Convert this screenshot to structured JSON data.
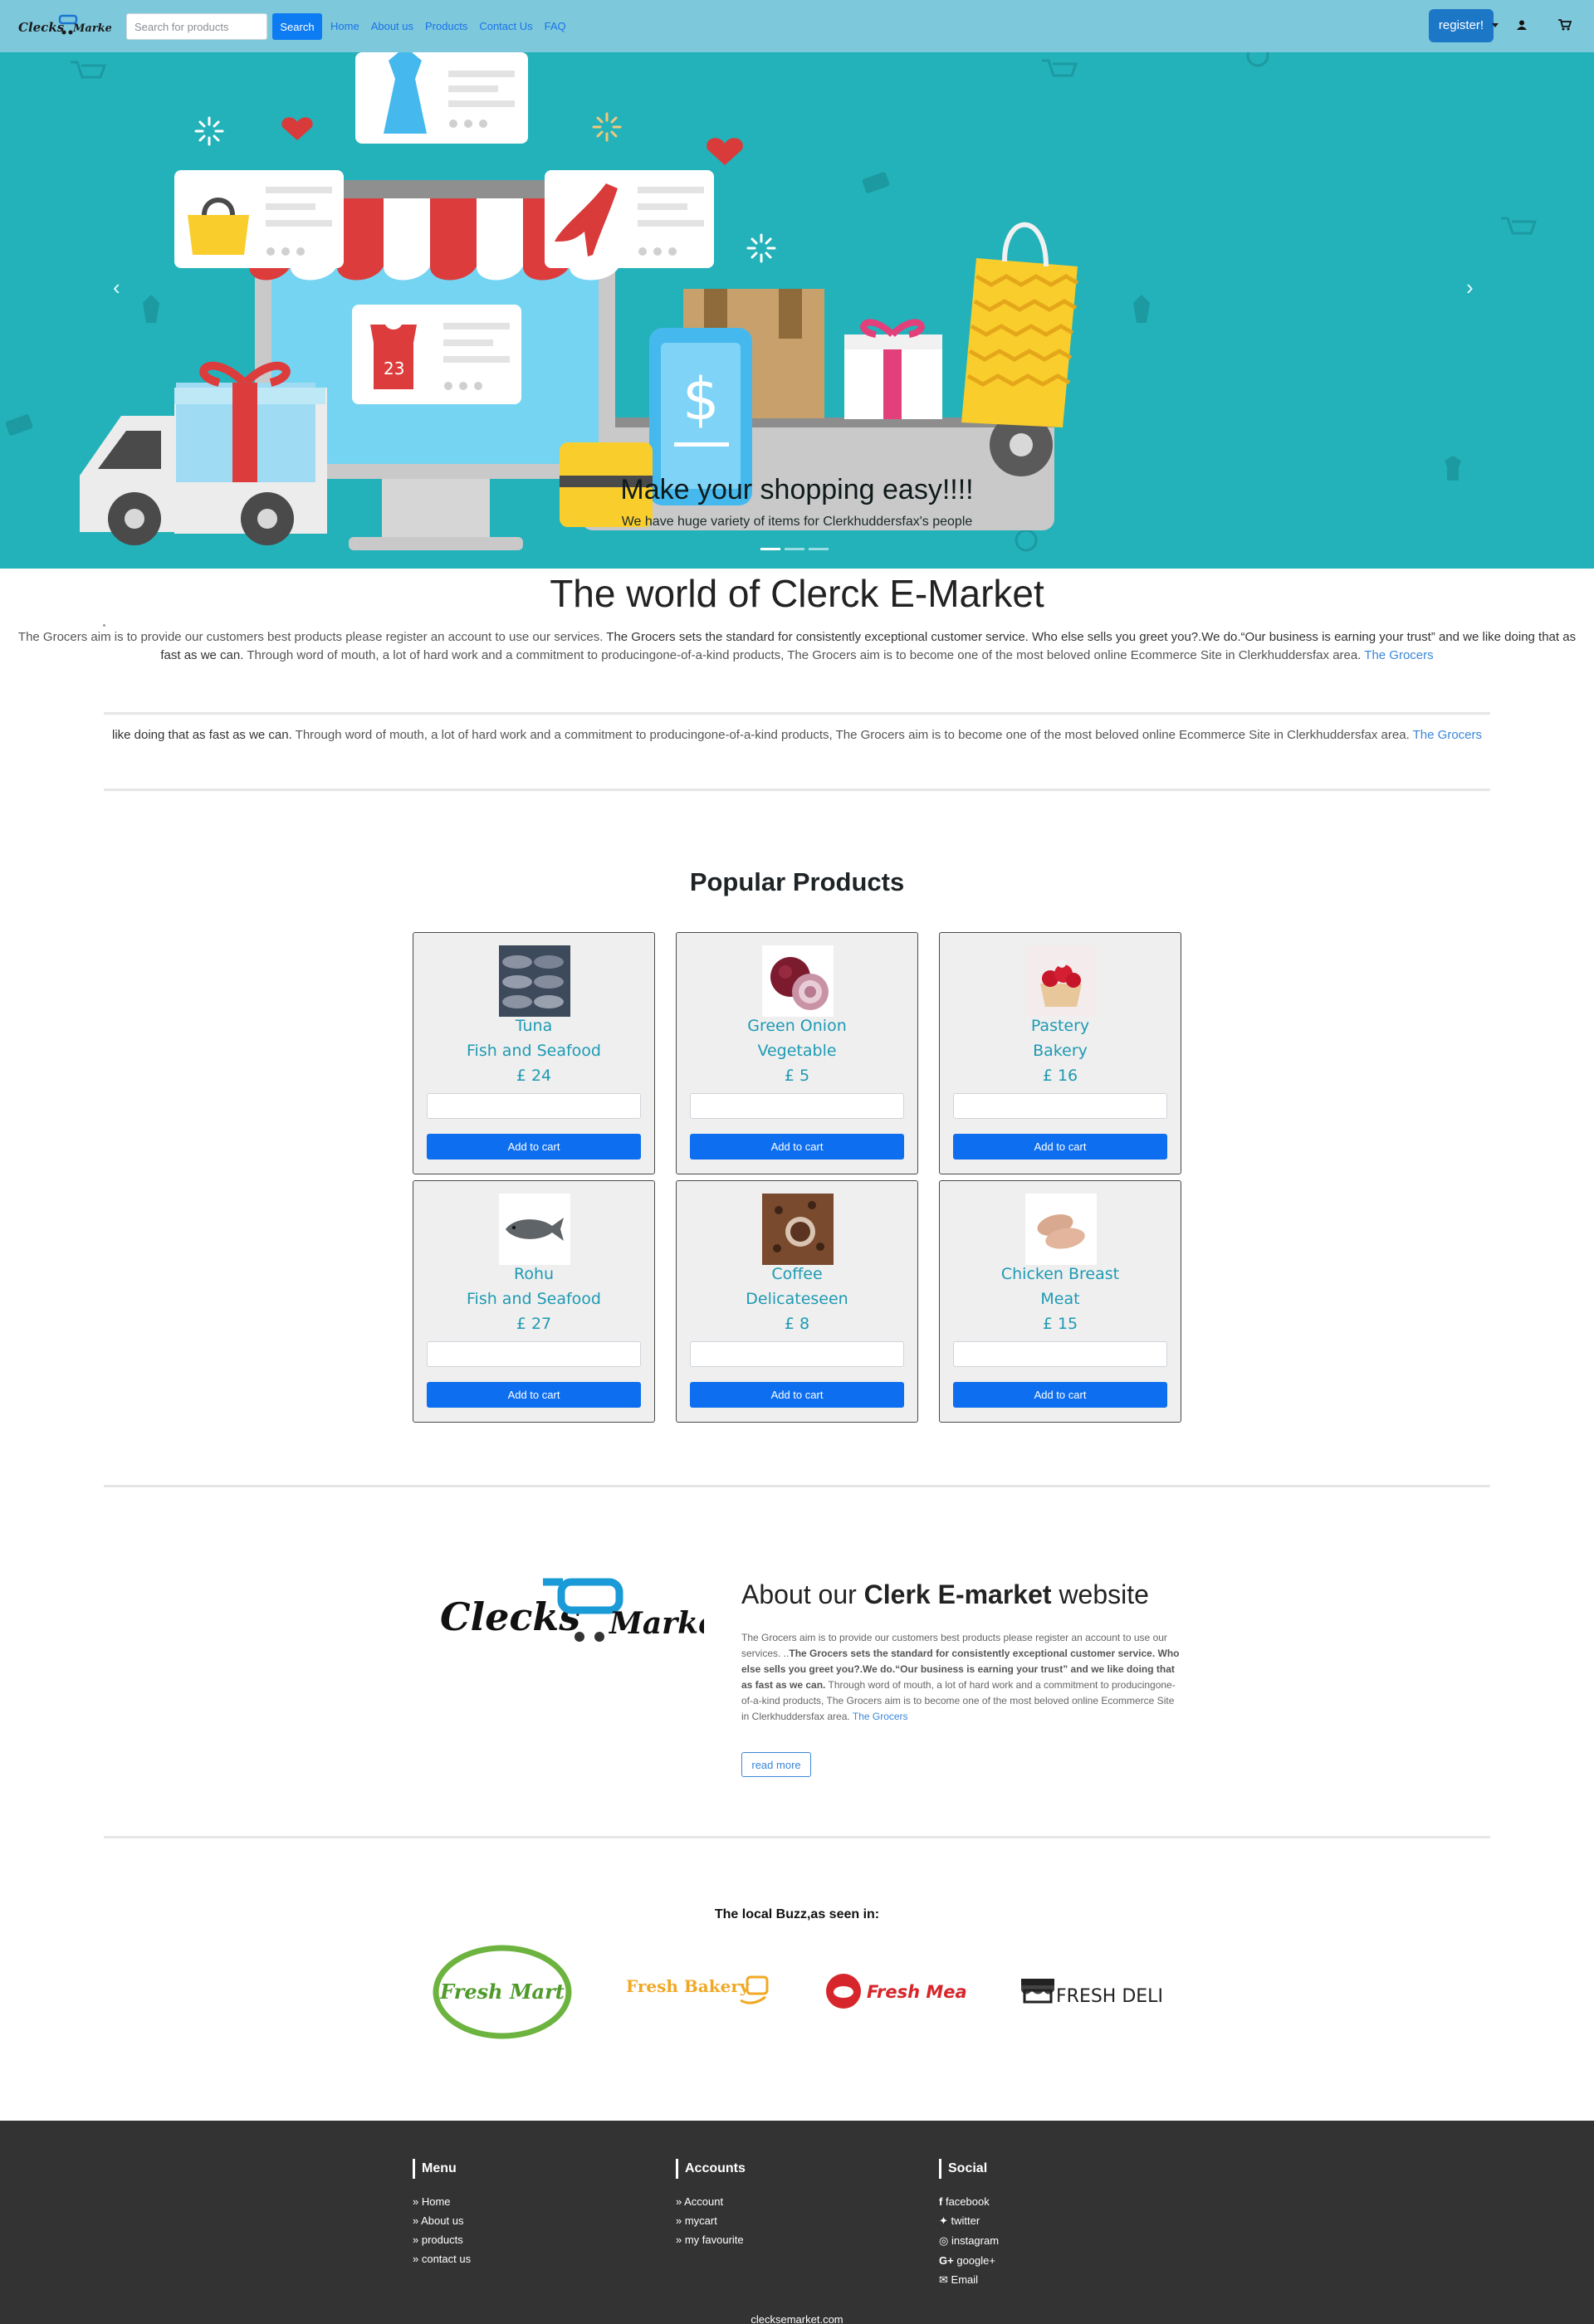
{
  "navbar": {
    "logo_text": "Clecks Market",
    "search_placeholder": "Search for products",
    "search_button": "Search",
    "links": [
      "Home",
      "About us",
      "Products",
      "Contact Us",
      "FAQ"
    ],
    "register_label": "register!"
  },
  "hero": {
    "title": "Make your shopping easy!!!!",
    "subtitle": "We have huge variety of items for Clerkhuddersfax's people",
    "prev_arrow": "‹",
    "next_arrow": "›",
    "slide_count": 3,
    "active_slide": 1
  },
  "intro": {
    "title": "The world of Clerck E-Market",
    "text_plain_1": "The Grocers aim is to provide our customers best products please register an account to use our services. ",
    "text_strong": "The Grocers sets the standard for consistently exceptional customer service. Who else sells you greet you?.We do.“Our business is earning your trust” and we like doing that as fast as we can.",
    "text_plain_2": " Through word of mouth, a lot of hard work and a commitment to producingone-of-a-kind products, The Grocers aim is to become one of the most beloved online Ecommerce Site in Clerkhuddersfax area. ",
    "text_link": "The Grocers",
    "repeat_strong": "like doing that as fast as we can.",
    "repeat_plain": " Through word of mouth, a lot of hard work and a commitment to producingone-of-a-kind products, The Grocers aim is to become one of the most beloved online Ecommerce Site in Clerkhuddersfax area. ",
    "repeat_link": "The Grocers"
  },
  "products": {
    "title": "Popular Products",
    "add_label": "Add to cart",
    "currency": "£",
    "items": [
      {
        "name": "Tuna",
        "category": "Fish and Seafood",
        "price": "£ 24",
        "image": "fish-icon"
      },
      {
        "name": "Green Onion",
        "category": "Vegetable",
        "price": "£ 5",
        "image": "onion-icon"
      },
      {
        "name": "Pastery",
        "category": "Bakery",
        "price": "£ 16",
        "image": "tart-icon"
      },
      {
        "name": "Rohu",
        "category": "Fish and Seafood",
        "price": "£ 27",
        "image": "fish-icon"
      },
      {
        "name": "Coffee",
        "category": "Delicateseen",
        "price": "£ 8",
        "image": "coffee-icon"
      },
      {
        "name": "Chicken Breast",
        "category": "Meat",
        "price": "£ 15",
        "image": "chicken-icon"
      }
    ]
  },
  "about": {
    "title_pre": "About our ",
    "title_bold": "Clerk E-market",
    "title_post": " website",
    "text_plain_1": "The Grocers aim is to provide our customers best products please register an account to use our services. ..",
    "text_strong": "The Grocers sets the standard for consistently exceptional customer service. Who else sells you greet you?.We do.“Our business is earning your trust” and we like doing that as fast as we can.",
    "text_plain_2": " Through word of mouth, a lot of hard work and a commitment to producingone-of-a-kind products, The Grocers aim is to become one of the most beloved online Ecommerce Site in Clerkhuddersfax area. ",
    "text_link": "The Grocers",
    "read_more": "read more",
    "logo_text_left": "Clecks",
    "logo_text_right": "Market"
  },
  "buzz": {
    "title": "The local Buzz,as seen in:",
    "partners": [
      "Fresh Mart",
      "Fresh Bakery",
      "Fresh Meat",
      "FRESH DELI"
    ]
  },
  "footer": {
    "menu": {
      "title": "Menu",
      "items": [
        "Home",
        "About us",
        "products",
        "contact us"
      ]
    },
    "accounts": {
      "title": "Accounts",
      "items": [
        "Account",
        "mycart",
        "my favourite"
      ]
    },
    "social": {
      "title": "Social",
      "items": [
        "facebook",
        "twitter",
        "instagram",
        "google+",
        "Email"
      ]
    },
    "site": "clecksemarket.com"
  },
  "colors": {
    "navbar": "#7ec8dc",
    "hero": "#23b2ba",
    "primary_button": "#0d6ef0",
    "product_text": "#1e9ab3",
    "footer": "#333333"
  }
}
